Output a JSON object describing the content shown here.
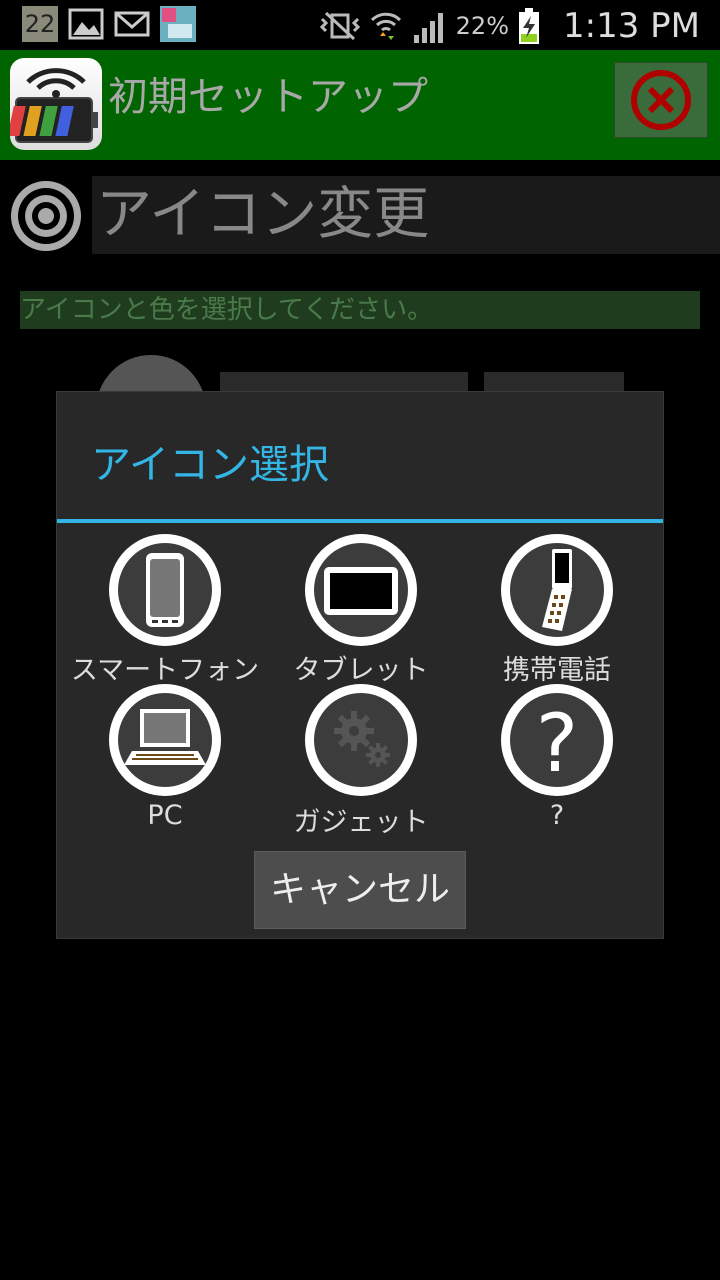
{
  "status_bar": {
    "notification_count": "22",
    "battery_percent": "22%",
    "time": "1:13 PM",
    "icons": [
      "notification-badge",
      "image-icon",
      "mail-icon",
      "app-thumbnail-icon",
      "vibrate-icon",
      "wifi-icon",
      "signal-icon",
      "battery-charging-icon"
    ]
  },
  "app_bar": {
    "title": "初期セットアップ",
    "icon": "battery-wifi-app-icon",
    "close_icon": "close-circle-icon"
  },
  "section": {
    "icon": "target-ring-icon",
    "title": "アイコン変更",
    "hint": "アイコンと色を選択してください。"
  },
  "dialog": {
    "title": "アイコン選択",
    "items": [
      {
        "label": "スマートフォン",
        "icon": "smartphone-icon"
      },
      {
        "label": "タブレット",
        "icon": "tablet-icon"
      },
      {
        "label": "携帯電話",
        "icon": "flip-phone-icon"
      },
      {
        "label": "PC",
        "icon": "laptop-icon"
      },
      {
        "label": "ガジェット",
        "icon": "gears-icon"
      },
      {
        "label": "?",
        "icon": "question-icon"
      }
    ],
    "cancel_label": "キャンセル"
  },
  "colors": {
    "accent": "#33b5e5",
    "app_bar": "#006400",
    "dialog_bg": "#282828",
    "close_red": "#b00000"
  }
}
